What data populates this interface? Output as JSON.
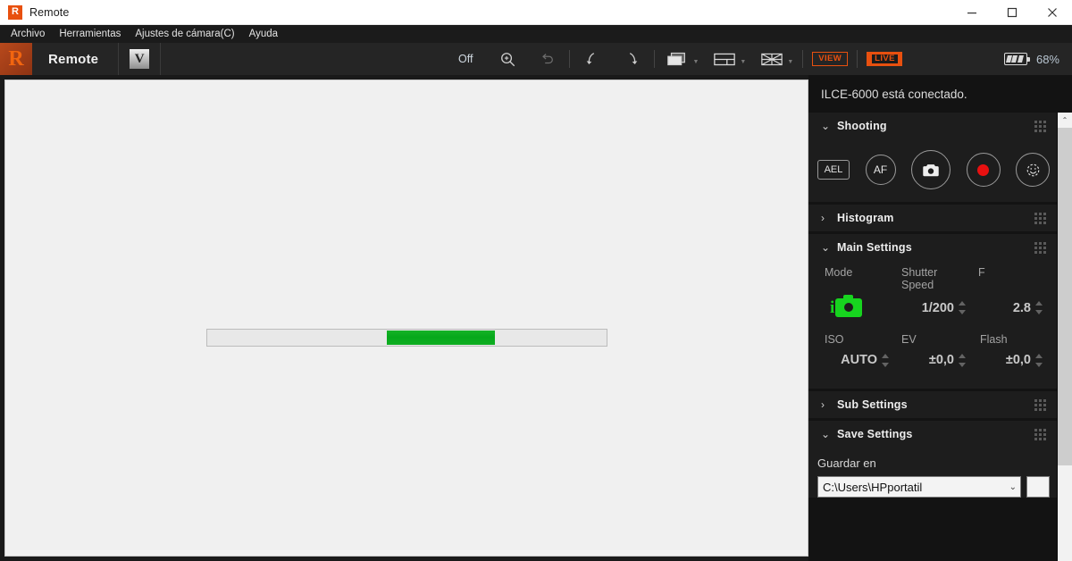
{
  "window": {
    "title": "Remote",
    "icon": "app-icon",
    "minimize_label": "—",
    "maximize_label": "□",
    "close_label": "✕"
  },
  "menubar": {
    "items": [
      {
        "label": "Archivo",
        "accel": "A"
      },
      {
        "label": "Herramientas",
        "accel": "t"
      },
      {
        "label": "Ajustes de cámara(C)",
        "accel": "C"
      },
      {
        "label": "Ayuda",
        "accel": "y"
      }
    ]
  },
  "toolbar": {
    "brand_glyph": "R",
    "brand_name": "Remote",
    "version_badge": "V",
    "off_label": "Off",
    "zoom_icon": "zoom-in-icon",
    "undo_icon": "undo-icon",
    "rotate_left_icon": "rotate-left-icon",
    "rotate_right_icon": "rotate-right-icon",
    "layout_single_icon": "layout-single-icon",
    "layout_split_icon": "layout-split-icon",
    "layout_grid_icon": "layout-grid-icon",
    "caret_label": "▼",
    "view_label": "VIEW",
    "live_label": "LIVE",
    "battery_icon": "battery-icon",
    "battery_percent": "68%"
  },
  "viewport": {
    "progress": {
      "type": "indeterminate",
      "chunk_left_percent": 45,
      "chunk_width_percent": 27,
      "color": "#0aac1e"
    }
  },
  "panel": {
    "status": "ILCE-6000 está conectado.",
    "sections": [
      {
        "id": "shooting",
        "title": "Shooting",
        "expanded": true,
        "chevron": "⌄",
        "buttons": [
          {
            "name": "ael-button",
            "label": "AEL"
          },
          {
            "name": "af-button",
            "label": "AF"
          },
          {
            "name": "shutter-button",
            "label": ""
          },
          {
            "name": "record-button",
            "label": ""
          },
          {
            "name": "smile-shutter-button",
            "label": ""
          }
        ]
      },
      {
        "id": "histogram",
        "title": "Histogram",
        "expanded": false,
        "chevron": "›"
      },
      {
        "id": "main-settings",
        "title": "Main Settings",
        "expanded": true,
        "chevron": "⌄",
        "fields": [
          {
            "label": "Mode",
            "value": "",
            "value_type": "icon",
            "icon": "intelligent-auto-icon"
          },
          {
            "label": "Shutter Speed",
            "value": "1/200",
            "value_type": "text",
            "spinner": true
          },
          {
            "label": "F",
            "value": "2.8",
            "value_type": "text",
            "spinner": true
          },
          {
            "label": "ISO",
            "value": "AUTO",
            "value_type": "text",
            "spinner": true
          },
          {
            "label": "EV",
            "value": "±0,0",
            "value_type": "text",
            "spinner": true
          },
          {
            "label": "Flash",
            "value": "±0,0",
            "value_type": "text",
            "spinner": true
          }
        ]
      },
      {
        "id": "sub-settings",
        "title": "Sub Settings",
        "expanded": false,
        "chevron": "›"
      },
      {
        "id": "save-settings",
        "title": "Save Settings",
        "expanded": true,
        "chevron": "⌄",
        "save_label": "Guardar en",
        "save_path": "C:\\Users\\HPportatil",
        "combo_caret": "⌄"
      }
    ],
    "scrollbar": {
      "up_arrow": "⌃"
    }
  },
  "colors": {
    "accent_orange": "#e8500f",
    "mode_green": "#17d41f",
    "record_red": "#e81010",
    "progress_green": "#0aac1e",
    "panel_bg": "#131313",
    "section_bg": "#1d1d1d",
    "toolbar_bg": "#252525"
  }
}
